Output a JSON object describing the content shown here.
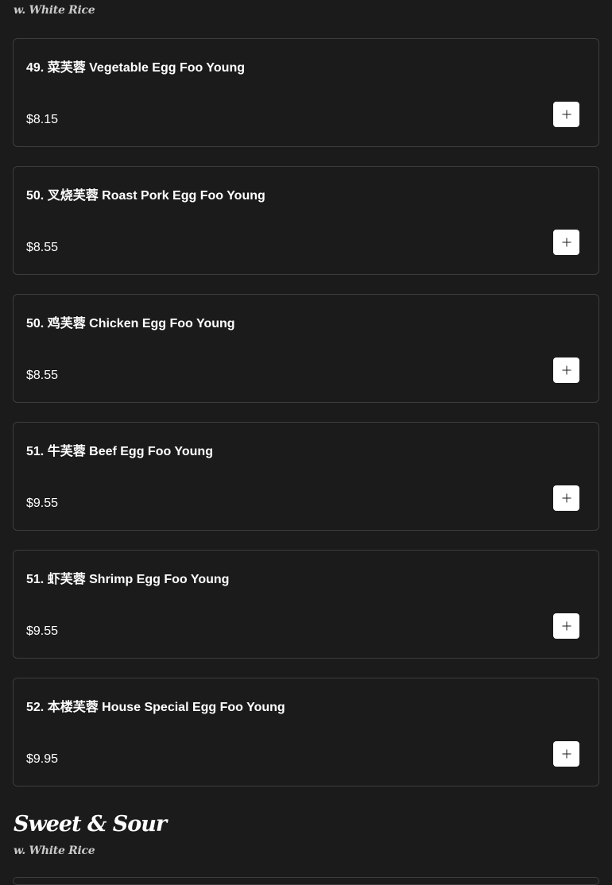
{
  "top_section": {
    "subtitle": "w. White Rice"
  },
  "items": [
    {
      "name": "49. 菜芙蓉 Vegetable Egg Foo Young",
      "price": "$8.15",
      "add_icon": "plus-icon"
    },
    {
      "name": "50. 叉烧芙蓉 Roast Pork Egg Foo Young",
      "price": "$8.55",
      "add_icon": "plus-icon"
    },
    {
      "name": "50. 鸡芙蓉 Chicken Egg Foo Young",
      "price": "$8.55",
      "add_icon": "plus-icon"
    },
    {
      "name": "51. 牛芙蓉 Beef Egg Foo Young",
      "price": "$9.55",
      "add_icon": "plus-icon"
    },
    {
      "name": "51. 虾芙蓉 Shrimp Egg Foo Young",
      "price": "$9.55",
      "add_icon": "plus-icon"
    },
    {
      "name": "52. 本楼芙蓉 House Special Egg Foo Young",
      "price": "$9.95",
      "add_icon": "plus-icon"
    }
  ],
  "next_section": {
    "title": "Sweet & Sour",
    "subtitle": "w. White Rice"
  },
  "colors": {
    "background": "#1b1b1c",
    "card_border": "#3d3d3e",
    "text": "#ffffff",
    "button_bg": "#ffffff"
  }
}
